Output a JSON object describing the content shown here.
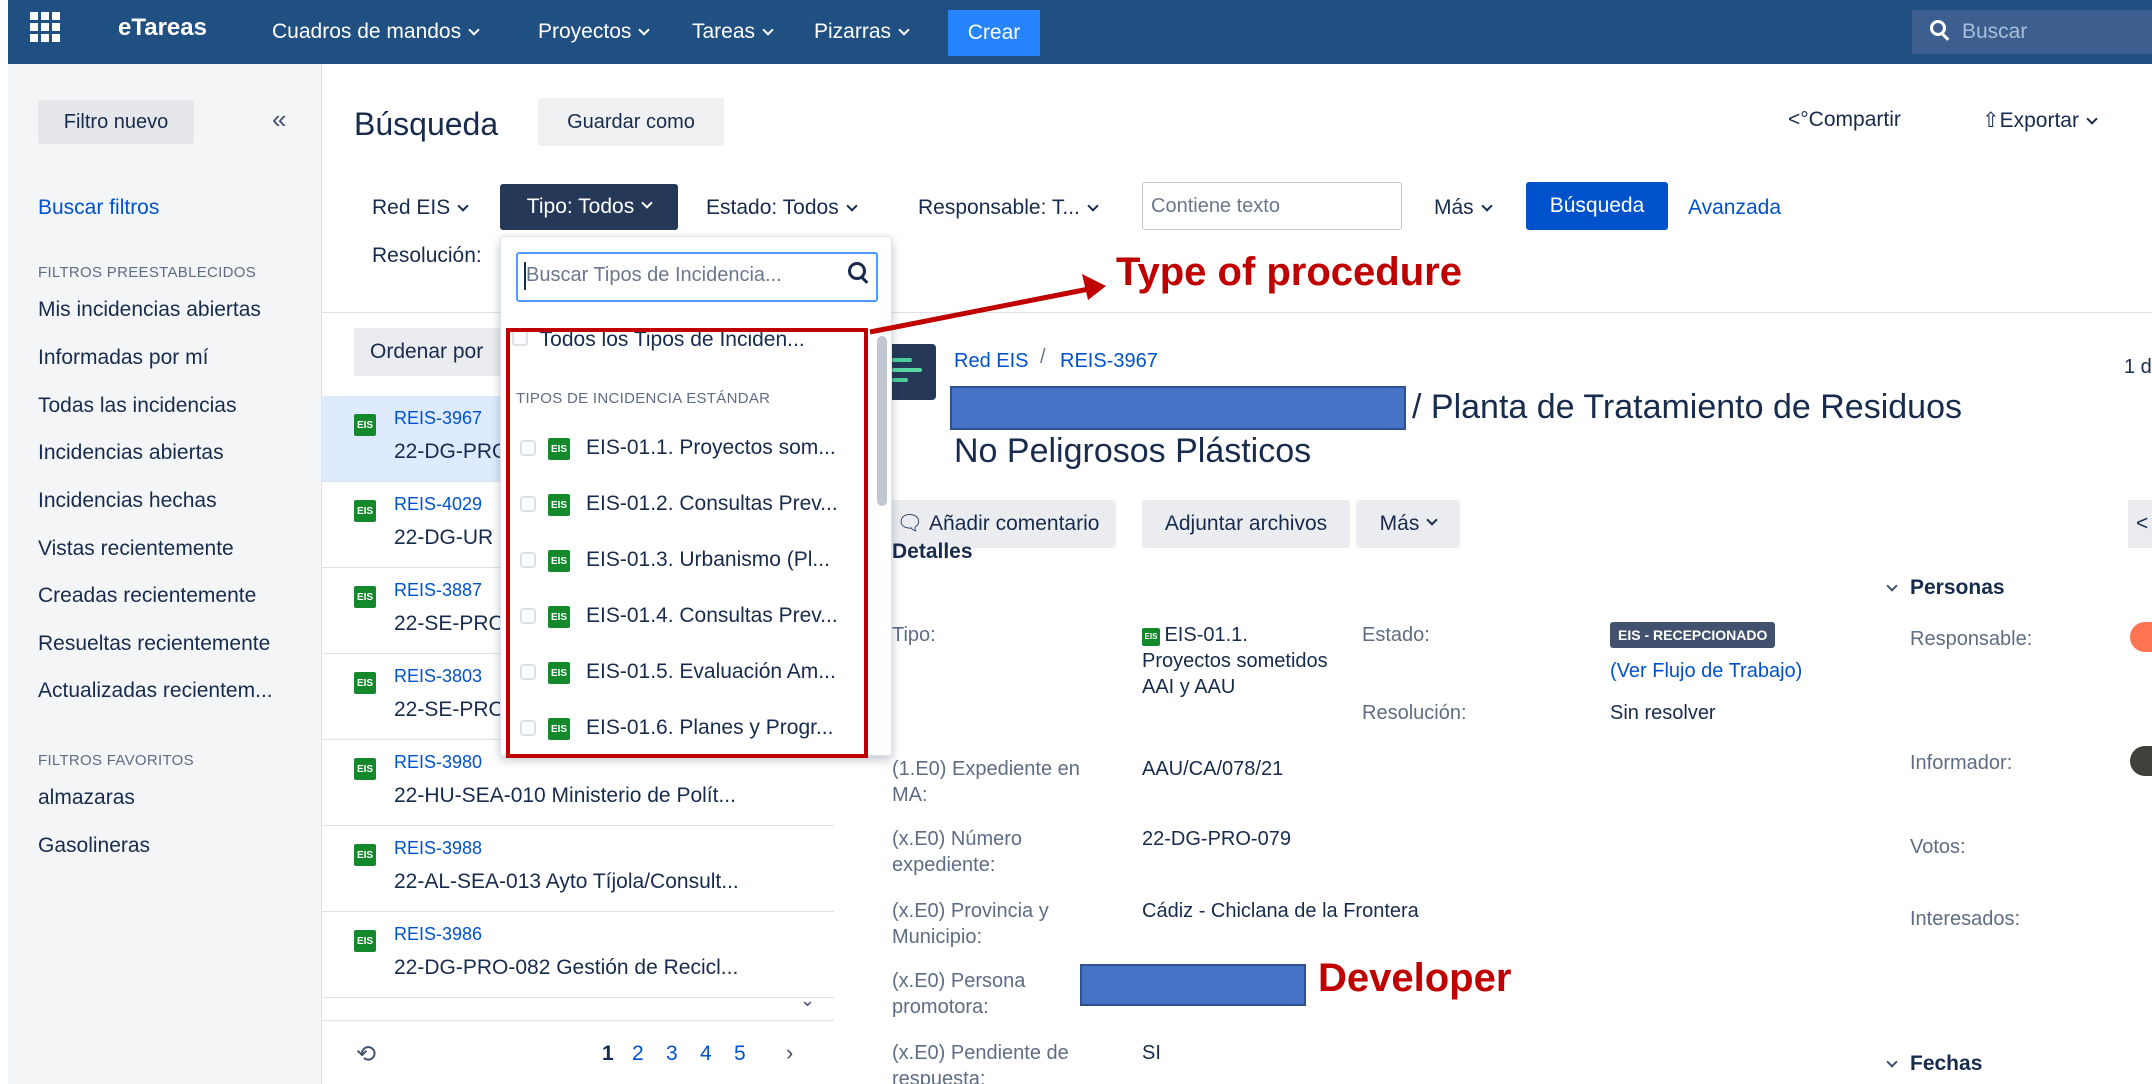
{
  "nav": {
    "logo": "eTareas",
    "items": [
      "Cuadros de mandos",
      "Proyectos",
      "Tareas",
      "Pizarras"
    ],
    "create": "Crear",
    "search_placeholder": "Buscar"
  },
  "sidebar": {
    "new_filter": "Filtro nuevo",
    "collapse": "«",
    "search_filters": "Buscar filtros",
    "preset_header": "FILTROS PREESTABLECIDOS",
    "preset": [
      "Mis incidencias abiertas",
      "Informadas por mí",
      "Todas las incidencias",
      "Incidencias abiertas",
      "Incidencias hechas",
      "Vistas recientemente",
      "Creadas recientemente",
      "Resueltas recientemente",
      "Actualizadas recientem..."
    ],
    "fav_header": "FILTROS FAVORITOS",
    "favorites": [
      "almazaras",
      "Gasolineras"
    ]
  },
  "header": {
    "title": "Búsqueda",
    "save_as": "Guardar como",
    "share": "Compartir",
    "export": "Exportar"
  },
  "filters": {
    "project": "Red EIS",
    "type": "Tipo: Todos",
    "status": "Estado: Todos",
    "assignee": "Responsable: T...",
    "text_placeholder": "Contiene texto",
    "more": "Más",
    "search": "Búsqueda",
    "advanced": "Avanzada",
    "resolution": "Resolución: "
  },
  "list": {
    "order": "Ordenar por",
    "rows": [
      {
        "key": "REIS-3967",
        "summary": "22-DG-PRO"
      },
      {
        "key": "REIS-4029",
        "summary": "22-DG-UR"
      },
      {
        "key": "REIS-3887",
        "summary": "22-SE-PRO"
      },
      {
        "key": "REIS-3803",
        "summary": "22-SE-PRO"
      },
      {
        "key": "REIS-3980",
        "summary": "22-HU-SEA-010 Ministerio de Polít..."
      },
      {
        "key": "REIS-3988",
        "summary": "22-AL-SEA-013 Ayto Tíjola/Consult..."
      },
      {
        "key": "REIS-3986",
        "summary": "22-DG-PRO-082 Gestión de Recicl..."
      }
    ],
    "pages": [
      "1",
      "2",
      "3",
      "4",
      "5"
    ],
    "next": "›"
  },
  "dropdown": {
    "search_placeholder": "Buscar Tipos de Incidencia...",
    "all": "Todos los Tipos de Inciden...",
    "section": "TIPOS DE INCIDENCIA ESTÁNDAR",
    "items": [
      "EIS-01.1. Proyectos som...",
      "EIS-01.2. Consultas Prev...",
      "EIS-01.3. Urbanismo (Pl...",
      "EIS-01.4. Consultas Prev...",
      "EIS-01.5. Evaluación Am...",
      "EIS-01.6. Planes y Progr..."
    ]
  },
  "detail": {
    "project": "Red EIS",
    "key": "REIS-3967",
    "count": "1 d",
    "title_line1": "/ Planta de Tratamiento de Residuos",
    "title_line2": "No Peligrosos Plásticos",
    "buttons": {
      "comment": "Añadir comentario",
      "attach": "Adjuntar archivos",
      "more": "Más"
    },
    "details_header": "Detalles",
    "type_label": "Tipo:",
    "type_value": "EIS-01.1. Proyectos sometidos AAI y AAU",
    "status_label": "Estado:",
    "status_value": "EIS - RECEPCIONADO",
    "workflow": "(Ver Flujo de Trabajo)",
    "resolution_label": "Resolución:",
    "resolution_value": "Sin resolver",
    "fields": [
      {
        "label": "(1.E0) Expediente en MA:",
        "value": "AAU/CA/078/21"
      },
      {
        "label": "(x.E0) Número expediente:",
        "value": "22-DG-PRO-079"
      },
      {
        "label": "(x.E0) Provincia y Municipio:",
        "value": "Cádiz - Chiclana de la Frontera"
      },
      {
        "label": "(x.E0) Persona promotora:",
        "value": ""
      },
      {
        "label": "(x.E0) Pendiente de respuesta:",
        "value": "SI"
      }
    ],
    "people_header": "Personas",
    "people": {
      "assignee": "Responsable:",
      "reporter": "Informador:",
      "votes": "Votos:",
      "watchers": "Interesados:"
    },
    "dates_header": "Fechas"
  },
  "annotations": {
    "type": "Type of procedure",
    "developer": "Developer",
    "color": "#c00000"
  }
}
